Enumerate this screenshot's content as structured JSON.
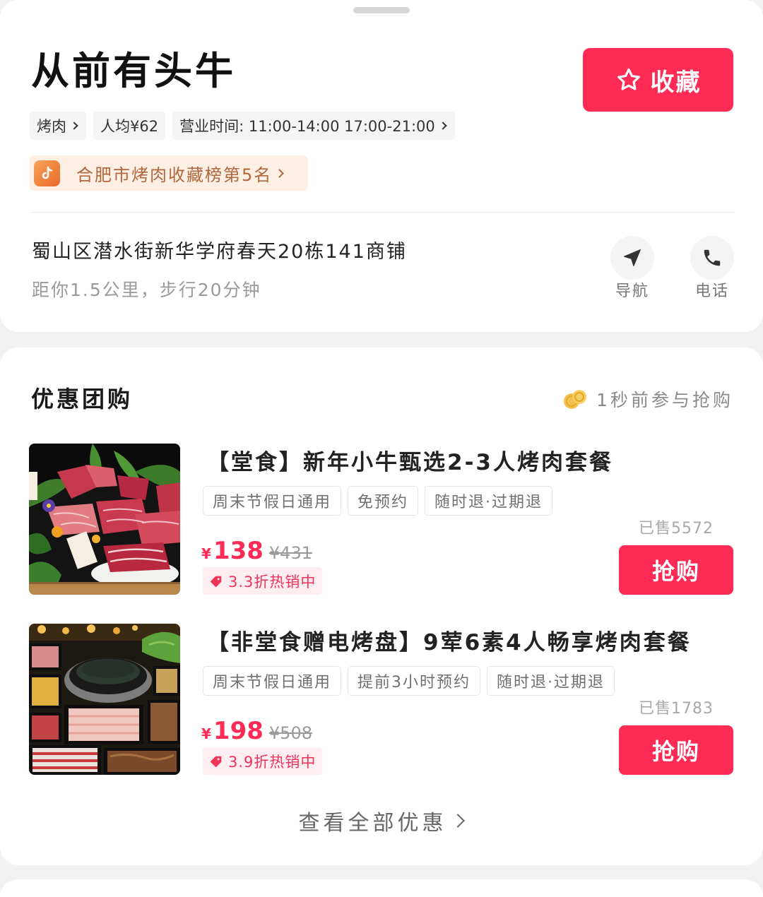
{
  "header": {
    "shop_name": "从前有头牛",
    "favorite": {
      "label": "收藏",
      "icon": "star-outline-icon"
    },
    "tags": [
      {
        "label": "烤肉",
        "icon": "chevron-right-icon"
      },
      {
        "label": "人均¥62"
      },
      {
        "label": "营业时间: 11:00-14:00 17:00-21:00",
        "icon": "chevron-right-icon"
      }
    ],
    "ranking": {
      "label": "合肥市烤肉收藏榜第5名",
      "icon": "douyin-logo-icon"
    }
  },
  "location": {
    "address": "蜀山区潜水街新华学府春天20栋141商铺",
    "distance": "距你1.5公里，步行20分钟",
    "actions": [
      {
        "label": "导航",
        "icon": "navigation-icon"
      },
      {
        "label": "电话",
        "icon": "phone-icon"
      }
    ]
  },
  "deals_section": {
    "title": "优惠团购",
    "activity": {
      "text": "1秒前参与抢购",
      "icon": "coins-icon"
    },
    "deals": [
      {
        "title": "【堂食】新年小牛甄选2-3人烤肉套餐",
        "tags": [
          "周末节假日通用",
          "免预约",
          "随时退·过期退"
        ],
        "sold": "已售5572",
        "currency": "¥",
        "price": "138",
        "original_price": "¥431",
        "discount": "3.3折热销中",
        "buy_label": "抢购"
      },
      {
        "title": "【非堂食赠电烤盘】9荤6素4人畅享烤肉套餐",
        "tags": [
          "周末节假日通用",
          "提前3小时预约",
          "随时退·过期退"
        ],
        "sold": "已售1783",
        "currency": "¥",
        "price": "198",
        "original_price": "¥508",
        "discount": "3.9折热销中",
        "buy_label": "抢购"
      }
    ],
    "view_all": {
      "label": "查看全部优惠",
      "icon": "chevron-right-icon"
    }
  },
  "colors": {
    "accent": "#fe2c55",
    "price": "#fe2c55",
    "ranking_text": "#b0673e",
    "ranking_bg": "#fdefe3",
    "discount_text": "#f0335b",
    "discount_bg": "#ffeef1",
    "page_bg": "#f2f2f2"
  }
}
